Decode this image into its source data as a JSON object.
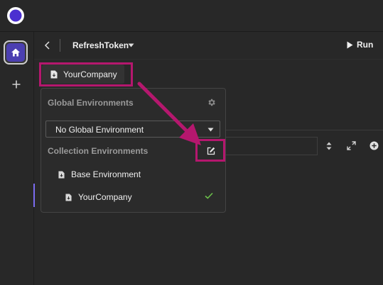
{
  "request": {
    "title": "RefreshToken",
    "run_label": "Run"
  },
  "env_button": {
    "label": "YourCompany"
  },
  "env_panel": {
    "global_heading": "Global Environments",
    "global_select_value": "No Global Environment",
    "collection_heading": "Collection Environments",
    "items": [
      {
        "label": "Base Environment"
      },
      {
        "label": "YourCompany",
        "selected": true
      }
    ]
  },
  "colors": {
    "accent": "#4b3fb1",
    "highlight": "#b5176e",
    "check": "#6bbf4a"
  },
  "icons": [
    "logo-icon",
    "home-icon",
    "plus-icon",
    "back-icon",
    "caret-down-icon",
    "play-icon",
    "file-icon",
    "gear-icon",
    "edit-icon",
    "check-icon",
    "sort-icon",
    "expand-icon",
    "add-circle-icon"
  ]
}
